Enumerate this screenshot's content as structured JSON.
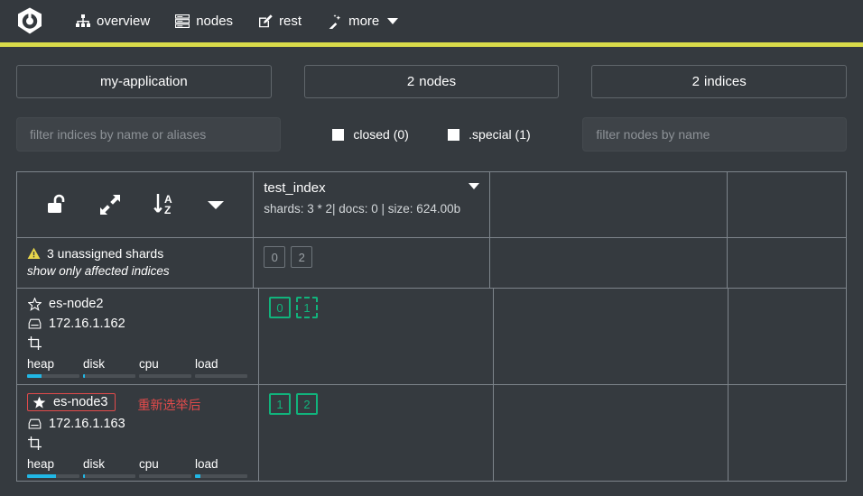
{
  "navbar": {
    "logo_icon": "cerebro-logo-icon",
    "items": [
      {
        "label": "overview",
        "icon": "sitemap-icon"
      },
      {
        "label": "nodes",
        "icon": "server-stack-icon"
      },
      {
        "label": "rest",
        "icon": "edit-square-icon"
      },
      {
        "label": "more",
        "icon": "magic-wand-icon",
        "has_caret": true
      }
    ],
    "status_color": "#d9db4a"
  },
  "summary": {
    "cluster_name": "my-application",
    "nodes_count": "2",
    "nodes_label": "nodes",
    "indices_count": "2",
    "indices_label": "indices"
  },
  "filters": {
    "indices_placeholder": "filter indices by name or aliases",
    "closed_label": "closed (0)",
    "special_label": ".special (1)",
    "nodes_placeholder": "filter nodes by name"
  },
  "table": {
    "header_icons": [
      {
        "name": "unlock-icon"
      },
      {
        "name": "expand-arrows-icon"
      },
      {
        "name": "sort-alpha-asc-icon"
      },
      {
        "name": "chevron-down-icon"
      }
    ],
    "index": {
      "name": "test_index",
      "meta": "shards: 3 * 2| docs: 0 | size: 624.00b"
    },
    "unassigned": {
      "warning": "3 unassigned shards",
      "link": "show only affected indices",
      "shards": [
        {
          "id": "0",
          "state": "unassigned"
        },
        {
          "id": "2",
          "state": "unassigned"
        }
      ]
    },
    "nodes": [
      {
        "name": "es-node2",
        "ip": "172.16.1.162",
        "role_icon": "star-outline-icon",
        "data_icon": "hdd-icon",
        "extra_icon": "crop-icon",
        "highlighted": false,
        "annotation": "",
        "shards": [
          {
            "id": "0",
            "state": "assigned"
          },
          {
            "id": "1",
            "state": "relocating"
          }
        ],
        "metrics": [
          {
            "label": "heap",
            "percent": 28
          },
          {
            "label": "disk",
            "percent": 4
          },
          {
            "label": "cpu",
            "percent": 0
          },
          {
            "label": "load",
            "percent": 0
          }
        ]
      },
      {
        "name": "es-node3",
        "ip": "172.16.1.163",
        "role_icon": "star-filled-icon",
        "data_icon": "hdd-icon",
        "extra_icon": "crop-icon",
        "highlighted": true,
        "annotation": "重新选举后",
        "shards": [
          {
            "id": "1",
            "state": "assigned"
          },
          {
            "id": "2",
            "state": "assigned"
          }
        ],
        "metrics": [
          {
            "label": "heap",
            "percent": 55
          },
          {
            "label": "disk",
            "percent": 4
          },
          {
            "label": "cpu",
            "percent": 0
          },
          {
            "label": "load",
            "percent": 10
          }
        ]
      }
    ]
  },
  "colors": {
    "accent_green": "#11b37c",
    "accent_blue": "#21b7e5",
    "warn_yellow": "#e8d64b",
    "alert_red": "#e24b4b",
    "status_bar": "#d9db4a"
  }
}
